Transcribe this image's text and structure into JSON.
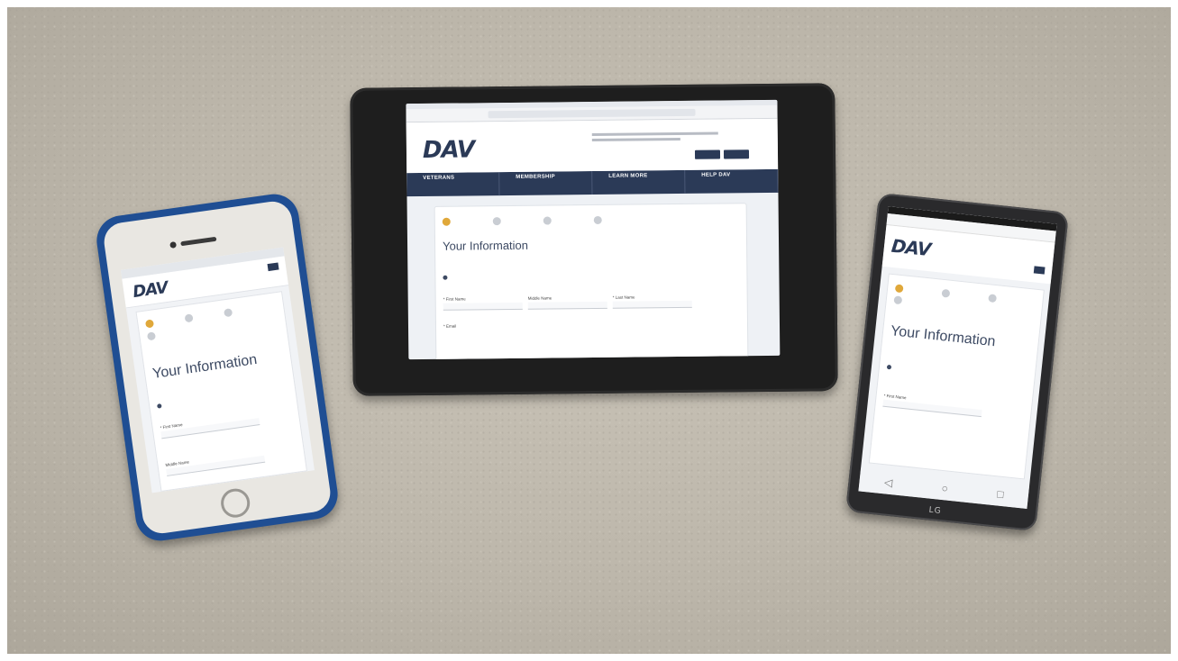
{
  "scene": {
    "background_color": "#bdb7ab",
    "accent_navy": "#2b3a57",
    "accent_green": "#8bbf3c",
    "accent_step": "#e0a83a"
  },
  "tablet": {
    "logo": "DAV",
    "nav": [
      {
        "title": "VETERANS"
      },
      {
        "title": "MEMBERSHIP"
      },
      {
        "title": "LEARN MORE"
      },
      {
        "title": "HELP DAV"
      }
    ],
    "heading": "Your Information",
    "fields": {
      "first": "* First Name",
      "middle": "Middle Name",
      "last": "* Last Name"
    },
    "email": "* Email"
  },
  "iphone": {
    "logo": "DAV",
    "heading": "Your Information",
    "field_first": "* First Name",
    "field_middle": "Middle Name"
  },
  "android": {
    "logo": "DAV",
    "heading": "Your Information",
    "field_first": "* First Name",
    "brand": "LG"
  }
}
